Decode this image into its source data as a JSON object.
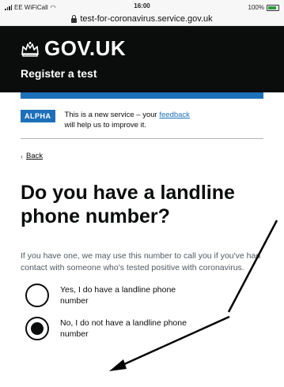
{
  "status_bar": {
    "carrier": "EE WiFiCall",
    "time": "16:00",
    "battery": "100%"
  },
  "browser": {
    "url": "test-for-coronavirus.service.gov.uk"
  },
  "header": {
    "logo_text": "GOV.UK",
    "service_name": "Register a test"
  },
  "phase_banner": {
    "tag": "ALPHA",
    "text_before": "This is a new service – your ",
    "link": "feedback",
    "text_after": " will help us to improve it."
  },
  "back_link": "Back",
  "question": {
    "title": "Do you have a landline phone number?",
    "hint": "If you have one, we may use this number to call you if you've had contact with someone who's tested positive with coronavirus."
  },
  "options": [
    {
      "label": "Yes, I do have a landline phone number",
      "selected": false
    },
    {
      "label": "No, I do not have a landline phone number",
      "selected": true
    }
  ],
  "colors": {
    "header": "#0b0c0c",
    "accent": "#1d70b8",
    "annotation": "#000000"
  }
}
